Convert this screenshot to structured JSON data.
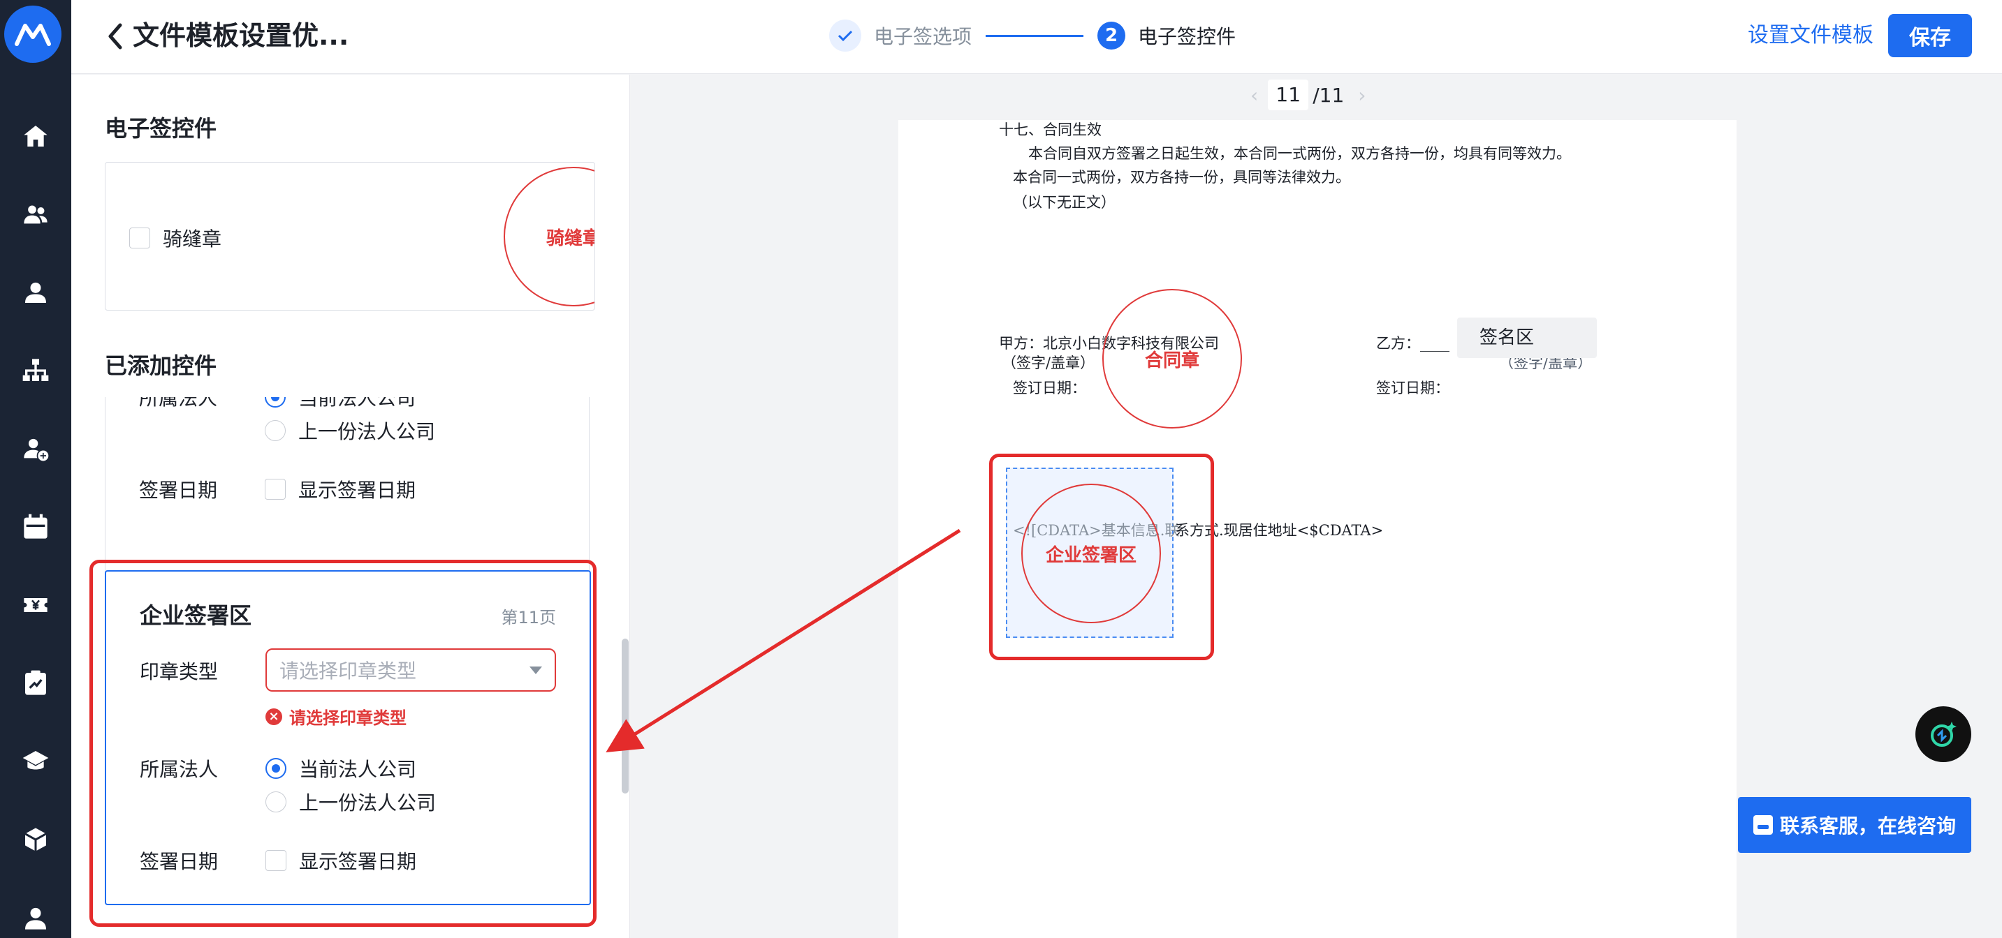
{
  "header": {
    "title": "文件模板设置优...",
    "steps": [
      {
        "label": "电子签选项",
        "state": "done"
      },
      {
        "label": "电子签控件",
        "state": "current",
        "number": "2"
      }
    ],
    "set_template_link": "设置文件模板",
    "save_label": "保存"
  },
  "panel": {
    "widgets_title": "电子签控件",
    "seam_seal_label": "骑缝章",
    "seam_seal_stamp": "骑缝章",
    "added_title": "已添加控件",
    "prev_card": {
      "legal_label": "所属法人",
      "legal_option_current": "当前法人公司",
      "legal_option_prev": "上一份法人公司",
      "date_label": "签署日期",
      "date_option": "显示签署日期"
    },
    "active_card": {
      "title": "企业签署区",
      "page": "第11页",
      "seal_type_label": "印章类型",
      "seal_type_placeholder": "请选择印章类型",
      "seal_type_error": "请选择印章类型",
      "legal_label": "所属法人",
      "legal_option_current": "当前法人公司",
      "legal_option_prev": "上一份法人公司",
      "date_label": "签署日期",
      "date_option": "显示签署日期"
    }
  },
  "pager": {
    "current": "11",
    "total": "/11"
  },
  "document": {
    "line1": "十七、合同生效",
    "line2": "本合同自双方签署之日起生效，本合同一式两份，双方各持一份，均具有同等效力。",
    "line3": "本合同一式两份，双方各持一份，具同等法律效力。",
    "line4": "（以下无正文）",
    "party_a": "甲方：北京小白数字科技有限公司",
    "party_a_sign": "（签字/盖章）",
    "party_a_date": "签订日期：",
    "party_b": "乙方：____",
    "party_b_sign": "（签字/盖章）",
    "party_b_date": "签订日期：",
    "contract_stamp": "合同章",
    "sign_zone": "签名区",
    "cdata_prefix": "<![CDATA>基本信息.联",
    "cdata_suffix": "系方式.现居住地址<$CDATA>",
    "enterprise_stamp": "企业签署区"
  },
  "support": {
    "label": "联系客服，在线咨询"
  },
  "colors": {
    "accent": "#1e6cf0",
    "error": "#e03a3a",
    "rail": "#1b2434",
    "annotation": "#e42b2b"
  },
  "icons": [
    "logo-icon",
    "home-icon",
    "team-icon",
    "user-icon",
    "org-icon",
    "add-user-icon",
    "calendar-icon",
    "yen-icon",
    "report-icon",
    "education-icon",
    "box-icon",
    "profile-icon",
    "ai-assistant-icon",
    "chat-icon"
  ]
}
